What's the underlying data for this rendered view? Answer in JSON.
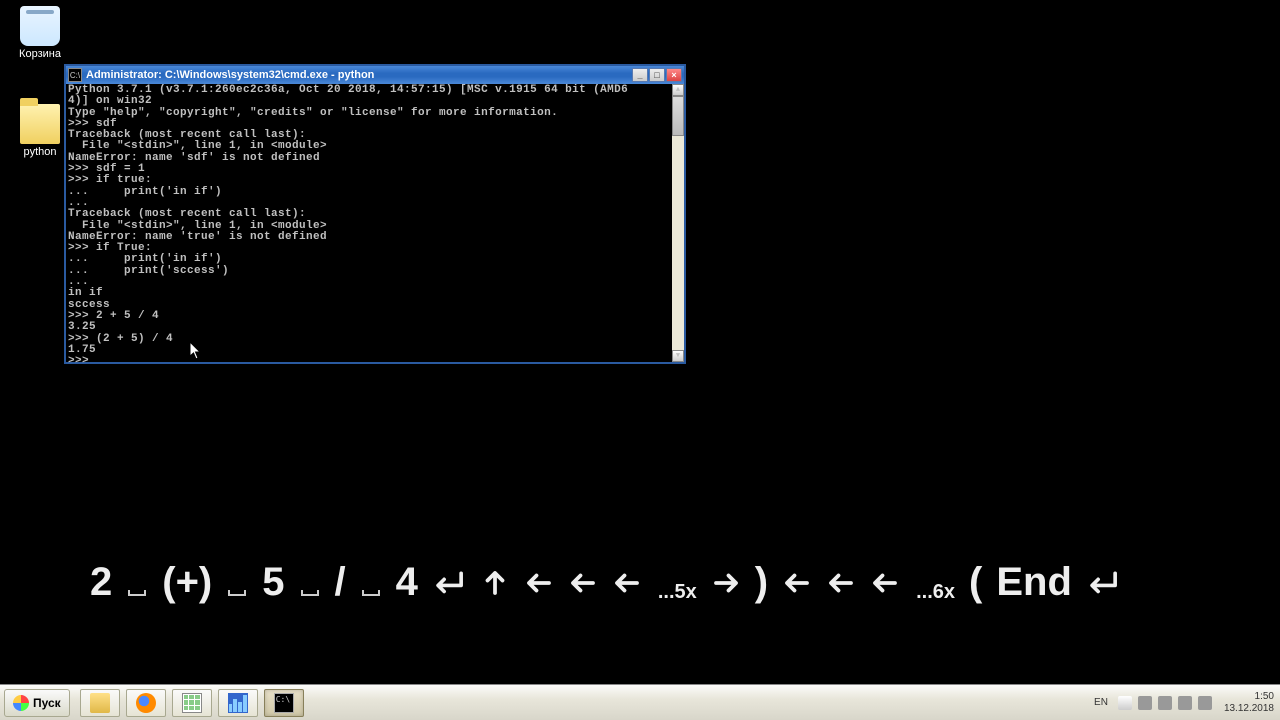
{
  "desktop": {
    "recycle_bin_label": "Корзина",
    "python_folder_label": "python"
  },
  "window": {
    "title": "Administrator: C:\\Windows\\system32\\cmd.exe - python",
    "console_lines": [
      "Python 3.7.1 (v3.7.1:260ec2c36a, Oct 20 2018, 14:57:15) [MSC v.1915 64 bit (AMD6",
      "4)] on win32",
      "Type \"help\", \"copyright\", \"credits\" or \"license\" for more information.",
      ">>> sdf",
      "Traceback (most recent call last):",
      "  File \"<stdin>\", line 1, in <module>",
      "NameError: name 'sdf' is not defined",
      ">>> sdf = 1",
      ">>> if true:",
      "...     print('in if')",
      "...",
      "Traceback (most recent call last):",
      "  File \"<stdin>\", line 1, in <module>",
      "NameError: name 'true' is not defined",
      ">>> if True:",
      "...     print('in if')",
      "...     print('sccess')",
      "...",
      "in if",
      "sccess",
      ">>> 2 + 5 / 4",
      "3.25",
      ">>> (2 + 5) / 4",
      "1.75",
      ">>> "
    ]
  },
  "keystrokes": {
    "seq": [
      "2",
      "SP",
      "(+)",
      "SP",
      "5",
      "SP",
      "/",
      "SP",
      "4",
      "ENTER",
      "UP",
      "LEFT",
      "LEFT",
      "LEFT",
      "...5x",
      "RIGHT",
      ")",
      "LEFT",
      "LEFT",
      "LEFT",
      "...6x",
      "(",
      "End",
      "ENTER"
    ]
  },
  "taskbar": {
    "start_label": "Пуск",
    "items": [
      {
        "name": "explorer",
        "icon": "folder"
      },
      {
        "name": "firefox",
        "icon": "firefox"
      },
      {
        "name": "calc",
        "icon": "calc"
      },
      {
        "name": "taskman",
        "icon": "taskman"
      },
      {
        "name": "cmd",
        "icon": "cmd",
        "active": true
      }
    ],
    "tray": {
      "lang": "EN",
      "time": "1:50",
      "date": "13.12.2018"
    }
  }
}
